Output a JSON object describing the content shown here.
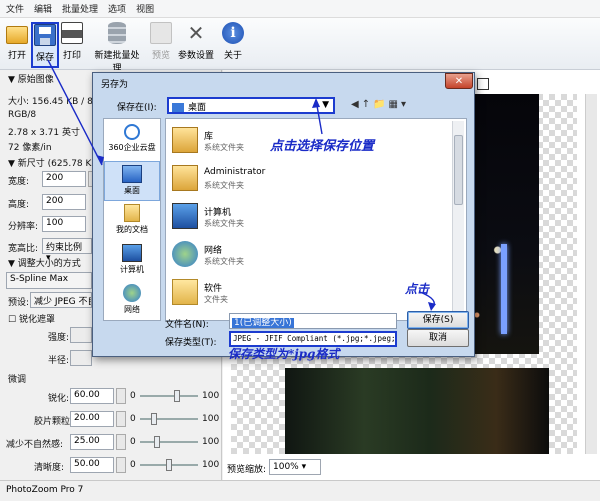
{
  "menubar": {
    "items": [
      "文件",
      "编辑",
      "批量处理",
      "选项",
      "视图"
    ]
  },
  "toolbar": {
    "open": "打开",
    "save": "保存",
    "print": "打印",
    "new_batch": "新建批量处理",
    "preview": "预览",
    "params": "参数设置",
    "about": "关于"
  },
  "left": {
    "original_header": "原始图像",
    "size": "大小: 156.45 KB / 8.68",
    "color_mode": "RGB/8",
    "dimensions": "2.78 x 3.71 英寸",
    "resolution": "72 像素/in",
    "new_size_header": "新尺寸 (625.78 KB)",
    "width_label": "宽度:",
    "width_value": "200",
    "height_label": "高度:",
    "height_value": "200",
    "resolution_label": "分辨率:",
    "resolution_value": "100",
    "aspect_label": "宽高比:",
    "aspect_value": "约束比例",
    "resize_method_header": "调整大小的方式",
    "method_value": "S-Spline Max",
    "preset_label": "预设:",
    "preset_value": "减少 JPEG 不自然",
    "sharpen_mask_label": "锐化遮罩",
    "strength_label": "强度:",
    "radius_label": "半径:",
    "tuning_header": "微调",
    "tune_rows": [
      {
        "label": "锐化:",
        "value": "60.00",
        "min": "0",
        "max": "100"
      },
      {
        "label": "胶片颗粒:",
        "value": "20.00",
        "min": "0",
        "max": "100"
      },
      {
        "label": "减少不自然感:",
        "value": "25.00",
        "min": "0",
        "max": "100"
      },
      {
        "label": "清晰度:",
        "value": "50.00",
        "min": "0",
        "max": "100"
      }
    ]
  },
  "preview": {
    "zoom_label": "预览缩放:",
    "zoom_value": "100%"
  },
  "status": {
    "app_name": "PhotoZoom Pro 7"
  },
  "dialog": {
    "title": "另存为",
    "save_in_label": "保存在(I):",
    "save_in_value": "桌面",
    "places": [
      "360企业云盘",
      "桌面",
      "我的文档",
      "计算机",
      "网络"
    ],
    "files": [
      {
        "name": "库",
        "sub": "系统文件夹"
      },
      {
        "name": "Administrator",
        "sub": "系统文件夹"
      },
      {
        "name": "计算机",
        "sub": "系统文件夹"
      },
      {
        "name": "网络",
        "sub": "系统文件夹"
      },
      {
        "name": "软件",
        "sub": "文件夹"
      }
    ],
    "filename_label": "文件名(N):",
    "filename_value": "1(已调整大小)",
    "filetype_label": "保存类型(T):",
    "filetype_value": "JPEG - JFIF Compliant (*.jpg;*.jpeg;*",
    "save_button": "保存(S)",
    "cancel_button": "取消"
  },
  "annotations": {
    "choose_location": "点击选择保存位置",
    "click": "点击",
    "save_type": "保存类型为*jpg格式"
  }
}
